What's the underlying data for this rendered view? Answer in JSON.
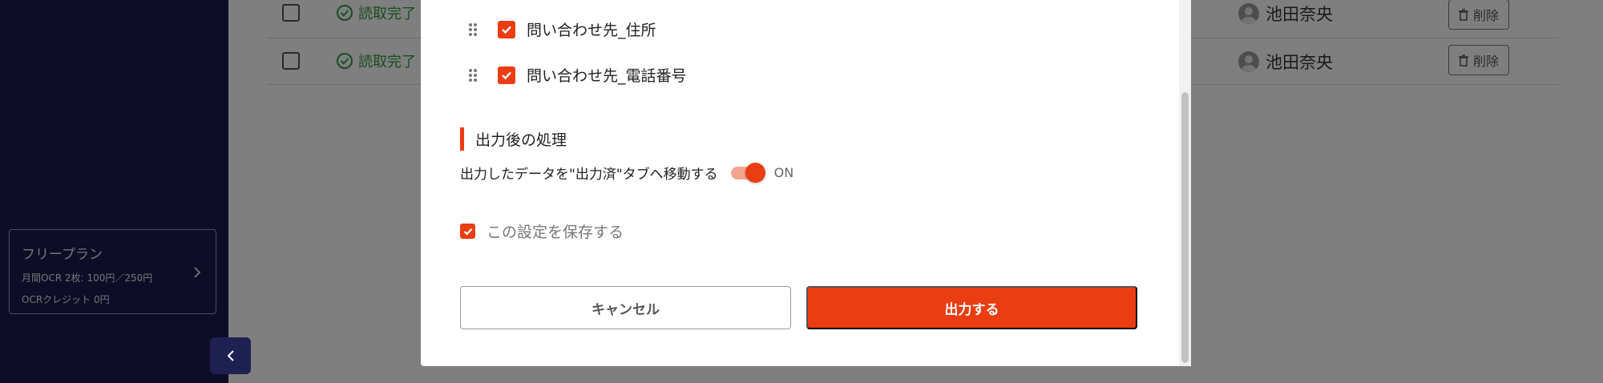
{
  "sidebar": {
    "plan": {
      "title": "フリープラン",
      "monthly_ocr": "月間OCR 2枚: 100円／250円",
      "credit": "OCRクレジット 0円"
    }
  },
  "list": {
    "rows": [
      {
        "status": "読取完了",
        "assignee": "池田奈央",
        "delete_label": "削除"
      },
      {
        "status": "読取完了",
        "assignee": "池田奈央",
        "delete_label": "削除"
      }
    ]
  },
  "modal": {
    "fields": [
      {
        "label": "問い合わせ先_住所",
        "checked": true
      },
      {
        "label": "問い合わせ先_電話番号",
        "checked": true
      }
    ],
    "post_process": {
      "title": "出力後の処理",
      "move_label": "出力したデータを\"出力済\"タブへ移動する",
      "toggle_state": "ON"
    },
    "save_setting_label": "この設定を保存する",
    "cancel_label": "キャンセル",
    "export_label": "出力する"
  },
  "colors": {
    "accent": "#ea3d12",
    "sidebar_bg": "#1b1b4f",
    "success": "#2e9a3e"
  }
}
